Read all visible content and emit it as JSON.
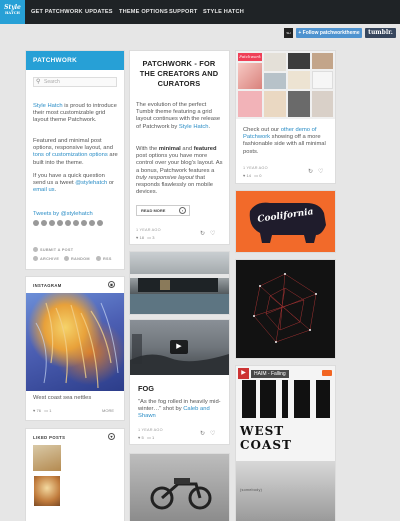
{
  "nav": {
    "logo_line1": "Style",
    "logo_line2": "HATCH",
    "items": [
      "GET PATCHWORK",
      "UPDATES",
      "THEME OPTIONS",
      "SUPPORT",
      "STYLE HATCH"
    ]
  },
  "follow": {
    "avatar_text": "SH",
    "button_label": "+ Follow patchworktheme",
    "tumblr_label": "tumblr."
  },
  "sidebar": {
    "title": "PATCHWORK",
    "search_placeholder": "Search",
    "intro_link": "Style Hatch",
    "intro_text": " is proud to introduce their most customizable grid layout theme Patchwork.",
    "p2_text": "Featured and minimal post options, responsive layout, and ",
    "p2_link": "tons of customization options",
    "p2_end": " are built into the theme.",
    "p3_text": "If you have a quick question send us a tweet ",
    "p3_link1": "@stylehatch",
    "p3_mid": " or ",
    "p3_link2": "email us",
    "p3_end": ".",
    "tweets_link": "Tweets by @stylehatch",
    "submit": "SUBMIT A POST",
    "archive": "ARCHIVE",
    "random": "RANDOM",
    "rss": "RSS"
  },
  "instagram": {
    "label": "INSTAGRAM",
    "caption": "West coast sea nettles",
    "likes": "76",
    "comments": "1",
    "more": "MORE"
  },
  "liked": {
    "label": "LIKED POSTS"
  },
  "text_post": {
    "title": "PATCHWORK - FOR THE CREATORS AND CURATORS",
    "p1": "The evolution of the perfect Tumblr theme featuring a grid layout continues with the release of Patchwork by ",
    "p1_link": "Style Hatch",
    "p1_end": ".",
    "p2_a": "With the ",
    "p2_b": "minimal",
    "p2_c": " and ",
    "p2_d": "featured",
    "p2_e": " post options you have more control over your blog's layout. As a bonus, Patchwork features a ",
    "p2_f": "truly responsive layout",
    "p2_g": " that responds flawlessly on mobile devices.",
    "readmore": "READ MORE",
    "time": "1 YEAR AGO",
    "notes": "18",
    "comments": "3"
  },
  "fog_post": {
    "title": "FOG",
    "text_a": "\"As the fog rolled in heavily mid-winter…\" shot by ",
    "text_link": "Caleb and Shawn",
    "time": "1 YEAR AGO",
    "notes": "5",
    "comments": "1"
  },
  "right_post": {
    "banner": "Patchwork",
    "text_a": "Check out our ",
    "text_link1": "other demo of Patchwork",
    "text_b": " showing off a more fashionable side with all minimal posts.",
    "time": "1 YEAR AGO",
    "notes": "14",
    "comments": "0"
  },
  "coolifornia": {
    "word": "Coolifornia"
  },
  "audio_post": {
    "track": "HAIM - Falling",
    "headline1": "WEST",
    "headline2": "COAST",
    "footer": "(somebody)"
  }
}
